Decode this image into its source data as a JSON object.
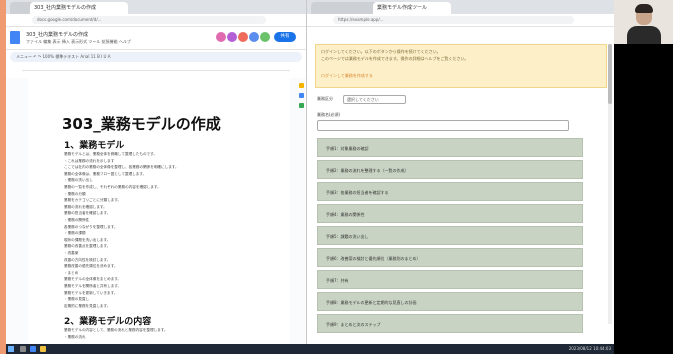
{
  "doc_window": {
    "tab_label": "303_社内業務モデルの作成",
    "address": "docs.google.com/document/d/...",
    "doc_title": "303_社内業務モデルの作成",
    "menu": "ファイル 編集 表示 挿入 表示形式 ツール 拡張機能 ヘルプ",
    "share_label": "共有",
    "toolbar_text": "メニュー  ↶ ↷  100%  標準テキスト  Arial  11  B I U A",
    "heading1": "303_業務モデルの作成",
    "section1": "1、業務モデル",
    "section2": "2、業務モデルの内容",
    "body_lines": [
      "業務モデルとは、業務全体を俯瞰して整理したものです。",
      "・これは業務の流れを示します",
      "ここでは社内の業務の全体像を整理し、各業務の関係を明確にします。",
      "業務の全体像は、業務フロー図として整理します。",
      "・業務の洗い出し",
      "業務の一覧を作成し、それぞれの業務の内容を確認します。",
      "・業務の分類",
      "業務をカテゴリごとに分類します。",
      "業務の流れを確認します。",
      "業務の担当者を確認します。",
      "・業務の関係性",
      "各業務のつながりを整理します。",
      "・業務の課題",
      "現状の課題を洗い出します。",
      "業務の改善点を整理します。",
      "・改善案",
      "改善の方向性を検討します。",
      "業務改善の優先順位を決めます。",
      "・まとめ",
      "業務モデルの全体像をまとめます。",
      "業務モデルを関係者と共有します。",
      "業務モデルを更新していきます。",
      "・業務の見直し",
      "定期的に業務を見直します。"
    ],
    "body_lines2": [
      "業務モデルの内容として、業務の流れと業務内容を整理します。",
      "・業務の流れ"
    ]
  },
  "web_window": {
    "tab_label": "業務モデル作成ツール",
    "address": "https://example.app/...",
    "banner_lines": [
      "ログインしてください。以下のボタンから操作を続けてください。",
      "このページでは業務モデルを作成できます。操作の詳細はヘルプをご覧ください。"
    ],
    "banner_link": "ログインして業務を作成する",
    "field1_label": "業務区分",
    "field1_value": "選択してください",
    "field2_label": "業務名(必須)",
    "accordions": [
      "手順1：対象業務の確認",
      "手順2：業務の流れを整理する（一覧の作成）",
      "手順3：各業務の担当者を確認する",
      "手順4：業務の関係性",
      "手順5：課題の洗い出し",
      "手順6：改善案の検討と優先順位（業務別のまとめ）",
      "手順7：共有",
      "手順8：業務モデルの更新と定期的な見直しの計画",
      "手順9：まとめと次のステップ"
    ]
  },
  "taskbar": {
    "clock": "2023/08/12  10:44:03"
  },
  "colors": {
    "frame": "#ef9a71",
    "share_button": "#1a73e8",
    "banner": "#fdf0c8",
    "accordion": "#c9d3c3",
    "taskbar": "#1f2836"
  }
}
